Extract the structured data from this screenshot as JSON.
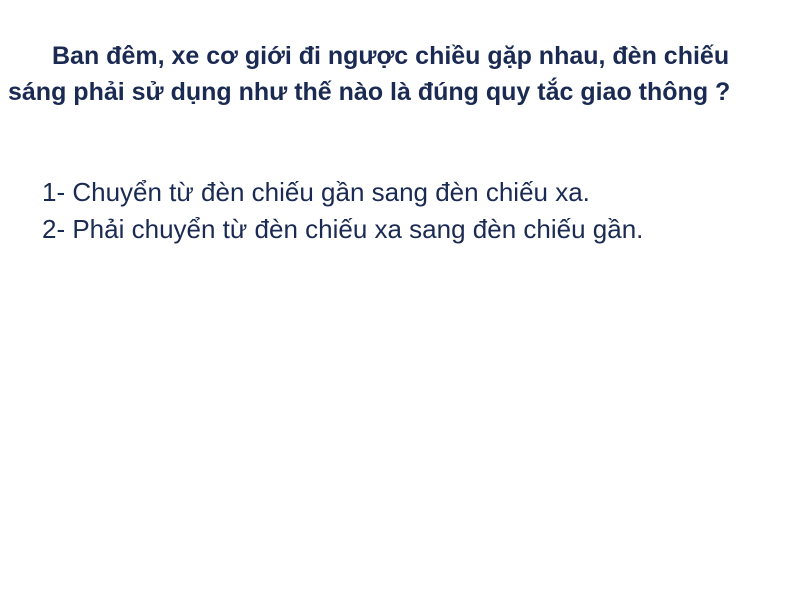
{
  "colors": {
    "background": "#ffffff",
    "text": "#1a2a52"
  },
  "question": {
    "text": "Ban đêm, xe cơ giới đi ngược chiều gặp nhau, đèn chiếu sáng phải sử dụng như thế nào là đúng quy tắc giao thông ?"
  },
  "answers": [
    {
      "label": "1- Chuyển từ đèn chiếu gần sang đèn chiếu xa."
    },
    {
      "label": "2- Phải chuyển từ đèn chiếu xa sang đèn chiếu gần."
    }
  ]
}
